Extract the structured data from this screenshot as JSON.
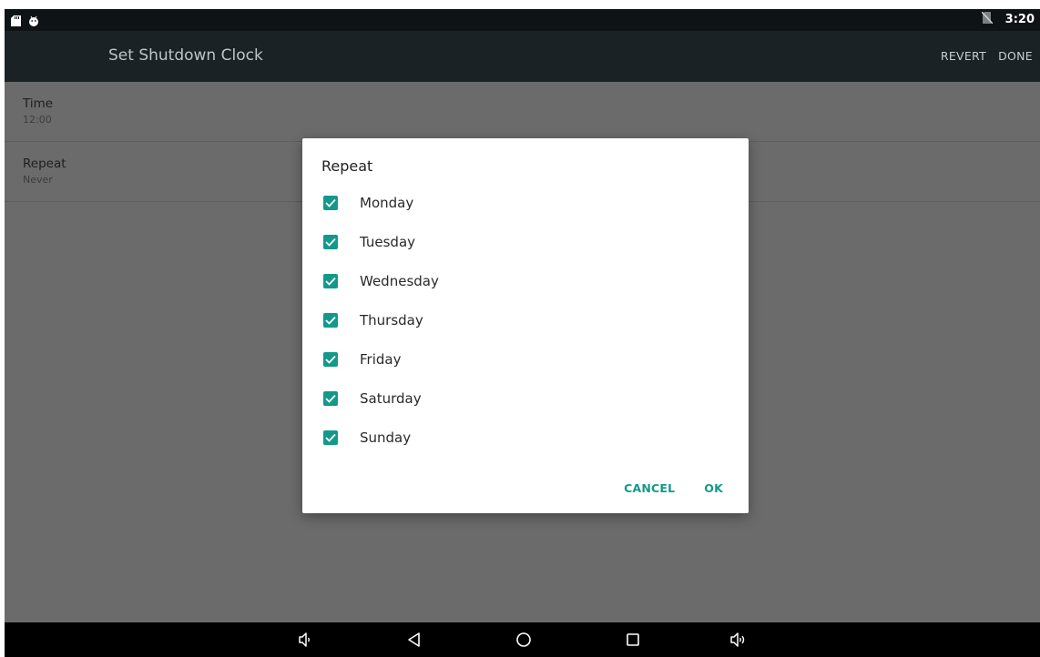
{
  "status_bar": {
    "time": "3:20",
    "left_icons": [
      "sd-card-icon",
      "android-icon"
    ],
    "right_icons": [
      "no-sim-icon"
    ]
  },
  "app_bar": {
    "title": "Set Shutdown Clock",
    "revert_label": "REVERT",
    "done_label": "DONE"
  },
  "preferences": [
    {
      "title": "Time",
      "summary": "12:00"
    },
    {
      "title": "Repeat",
      "summary": "Never"
    }
  ],
  "dialog": {
    "title": "Repeat",
    "options": [
      {
        "label": "Monday",
        "checked": true
      },
      {
        "label": "Tuesday",
        "checked": true
      },
      {
        "label": "Wednesday",
        "checked": true
      },
      {
        "label": "Thursday",
        "checked": true
      },
      {
        "label": "Friday",
        "checked": true
      },
      {
        "label": "Saturday",
        "checked": true
      },
      {
        "label": "Sunday",
        "checked": true
      }
    ],
    "cancel_label": "CANCEL",
    "ok_label": "OK"
  },
  "nav_bar": {
    "buttons": [
      "volume-down-icon",
      "back-icon",
      "home-icon",
      "recents-icon",
      "volume-up-icon"
    ]
  },
  "colors": {
    "accent": "#13998b",
    "scrim": "#6b6b6b",
    "app_bar": "#1a2226",
    "status_bar": "#0e1315"
  }
}
